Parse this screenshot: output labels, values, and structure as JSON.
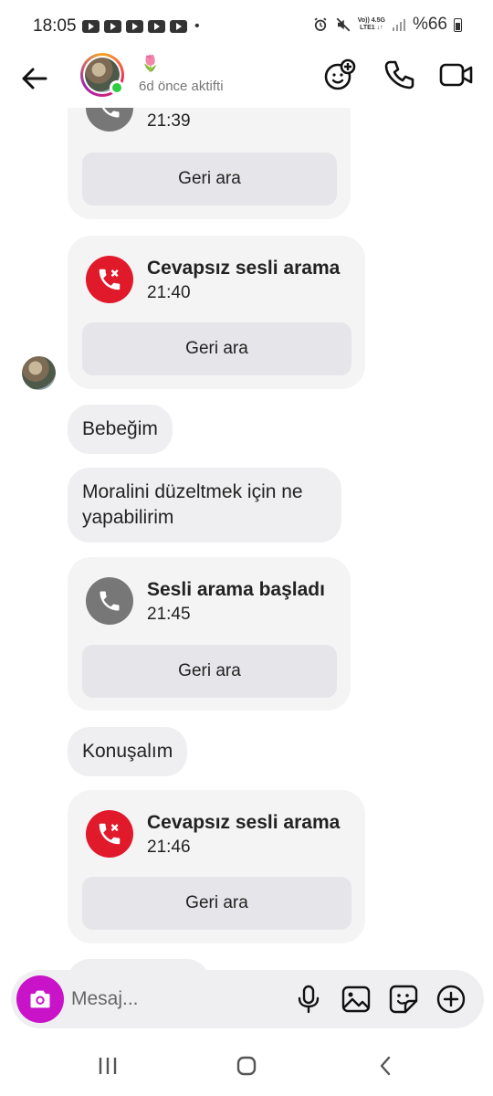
{
  "status_bar": {
    "time": "18:05",
    "dot": "•",
    "net_top": "Vo)) 4.5G",
    "net_bottom": "LTE1 ↓↑",
    "battery": "%66"
  },
  "header": {
    "emoji": "🌷",
    "active_status": "6d önce aktifti",
    "icons": [
      "back-arrow-icon",
      "add-person-icon",
      "phone-icon",
      "video-icon"
    ]
  },
  "messages": [
    {
      "type": "call",
      "title": "",
      "time": "21:39",
      "button": "Geri ara",
      "icon": "phone-gray"
    },
    {
      "type": "call",
      "title": "Cevapsız sesli arama",
      "time": "21:40",
      "button": "Geri ara",
      "icon": "missed"
    },
    {
      "type": "text",
      "text": "Bebeğim"
    },
    {
      "type": "text",
      "text": "Moralini düzeltmek için ne yapabilirim"
    },
    {
      "type": "call",
      "title": "Sesli arama başladı",
      "time": "21:45",
      "button": "Geri ara",
      "icon": "started"
    },
    {
      "type": "text",
      "text": "Konuşalım"
    },
    {
      "type": "call",
      "title": "Cevapsız sesli arama",
      "time": "21:46",
      "button": "Geri ara",
      "icon": "missed"
    }
  ],
  "composer": {
    "placeholder": "Mesaj..."
  },
  "colors": {
    "missed": "#e0192b",
    "camera": "#c913c9",
    "online": "#2ecc40"
  }
}
